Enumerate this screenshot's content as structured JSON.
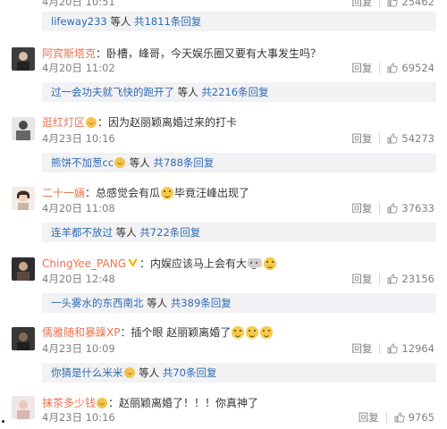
{
  "top_partial": {
    "time": "4月20日 10:51",
    "reply_label": "回复",
    "likes": "25462"
  },
  "threads": [
    {
      "reply_bar": {
        "users": "lifeway233",
        "mid": " 等人 ",
        "count": "共1811条回复"
      }
    },
    {
      "user": "阿宾斯塔克",
      "text": "：卧槽，峰哥，今天娱乐圈又要有大事发生吗？",
      "time": "4月20日 11:02",
      "reply_label": "回复",
      "likes": "69524",
      "reply_bar": {
        "users": "过一会功夫就飞快的跑开了",
        "mid": " 等人 ",
        "count": "共2216条回复"
      }
    },
    {
      "user": "逛红灯区",
      "text": "：因为赵丽颖离婚过来的打卡",
      "time": "4月23日 10:16",
      "reply_label": "回复",
      "likes": "54273",
      "reply_bar": {
        "users": "熊饼不加葱cc",
        "mid": " 等人 ",
        "count": "共788条回复"
      }
    },
    {
      "user": "二十一婳",
      "text_a": "：总感觉会有瓜",
      "text_b": "毕竟汪峰出现了",
      "time": "4月20日 11:08",
      "reply_label": "回复",
      "likes": "37633",
      "reply_bar": {
        "users": "连羊都不放过",
        "mid": " 等人 ",
        "count": "共722条回复"
      }
    },
    {
      "user": "ChingYee_PANG",
      "text": "：内娱应该马上会有大",
      "time": "4月20日 12:48",
      "reply_label": "回复",
      "likes": "23156",
      "reply_bar": {
        "users": "一头雾水的东西南北",
        "mid": " 等人 ",
        "count": "共389条回复"
      }
    },
    {
      "user": "儒雅随和暴躁XP",
      "text": "：插个眼 赵丽颖离婚了",
      "time": "4月23日 10:09",
      "reply_label": "回复",
      "likes": "12964",
      "reply_bar": {
        "users": "你猜是什么米米",
        "mid": " 等人 ",
        "count": "共70条回复"
      }
    },
    {
      "user": "抹茶多少钱",
      "text": "：赵丽颖离婚了！！！你真神了",
      "time": "4月23日 10:16",
      "reply_label": "回复",
      "likes": "9765"
    }
  ],
  "colors": {
    "link": "#eb7350",
    "muted": "#808080",
    "bar_bg": "#f2f2f5"
  }
}
